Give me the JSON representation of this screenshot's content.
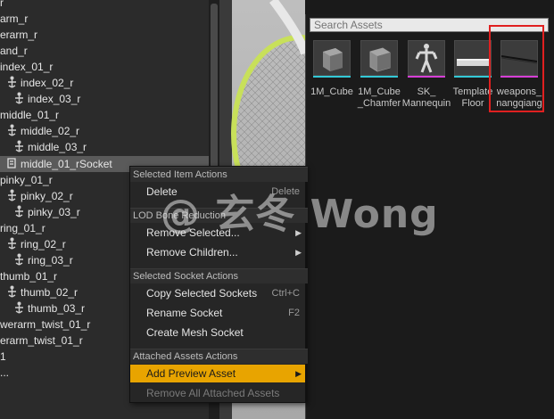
{
  "tree": {
    "rows": [
      {
        "label": "r",
        "x": 0
      },
      {
        "label": "arm_r",
        "x": 0
      },
      {
        "label": "erarm_r",
        "x": 0
      },
      {
        "label": "and_r",
        "x": 0
      },
      {
        "label": "index_01_r",
        "x": 0
      },
      {
        "label": "index_02_r",
        "x": 8
      },
      {
        "label": "index_03_r",
        "x": 16
      },
      {
        "label": "middle_01_r",
        "x": 0
      },
      {
        "label": "middle_02_r",
        "x": 8
      },
      {
        "label": "middle_03_r",
        "x": 16
      },
      {
        "label": "middle_01_rSocket",
        "x": 8
      },
      {
        "label": "pinky_01_r",
        "x": 0
      },
      {
        "label": "pinky_02_r",
        "x": 8
      },
      {
        "label": "pinky_03_r",
        "x": 16
      },
      {
        "label": "ring_01_r",
        "x": 0
      },
      {
        "label": "ring_02_r",
        "x": 8
      },
      {
        "label": "ring_03_r",
        "x": 16
      },
      {
        "label": "thumb_01_r",
        "x": 0
      },
      {
        "label": "thumb_02_r",
        "x": 8
      },
      {
        "label": "thumb_03_r",
        "x": 16
      },
      {
        "label": "werarm_twist_01_r",
        "x": 0
      },
      {
        "label": "erarm_twist_01_r",
        "x": 0
      },
      {
        "label": "1",
        "x": 0
      },
      {
        "label": "...",
        "x": 0
      }
    ],
    "selected_index": 10
  },
  "asset_picker": {
    "search_placeholder": "Search Assets",
    "assets": [
      {
        "name": "1M_Cube",
        "bar": "#33c9d6"
      },
      {
        "name": "1M_Cube\n_Chamfer",
        "bar": "#33c9d6"
      },
      {
        "name": "SK_\nMannequin",
        "bar": "#d63fd6"
      },
      {
        "name": "Template\nFloor",
        "bar": "#33c9d6"
      },
      {
        "name": "weapons_\nnangqiang",
        "bar": "#d63fd6"
      }
    ]
  },
  "context_menu": {
    "sections": {
      "selected_item": "Selected Item Actions",
      "lod_bone": "LOD Bone Reduction",
      "selected_socket": "Selected Socket Actions",
      "attached_assets": "Attached Assets Actions"
    },
    "delete": {
      "label": "Delete",
      "shortcut": "Delete"
    },
    "remove_selected": {
      "label": "Remove Selected..."
    },
    "remove_children": {
      "label": "Remove Children..."
    },
    "copy_sockets": {
      "label": "Copy Selected Sockets",
      "shortcut": "Ctrl+C"
    },
    "rename_socket": {
      "label": "Rename Socket",
      "shortcut": "F2"
    },
    "create_mesh_socket": {
      "label": "Create Mesh Socket"
    },
    "add_preview_asset": {
      "label": "Add Preview Asset"
    },
    "remove_all_attached": {
      "label": "Remove All Attached Assets"
    }
  },
  "watermark": "@ 玄冬 Wong",
  "colors": {
    "highlight_menu": "#e8a400",
    "annotation_box": "#e02020"
  }
}
